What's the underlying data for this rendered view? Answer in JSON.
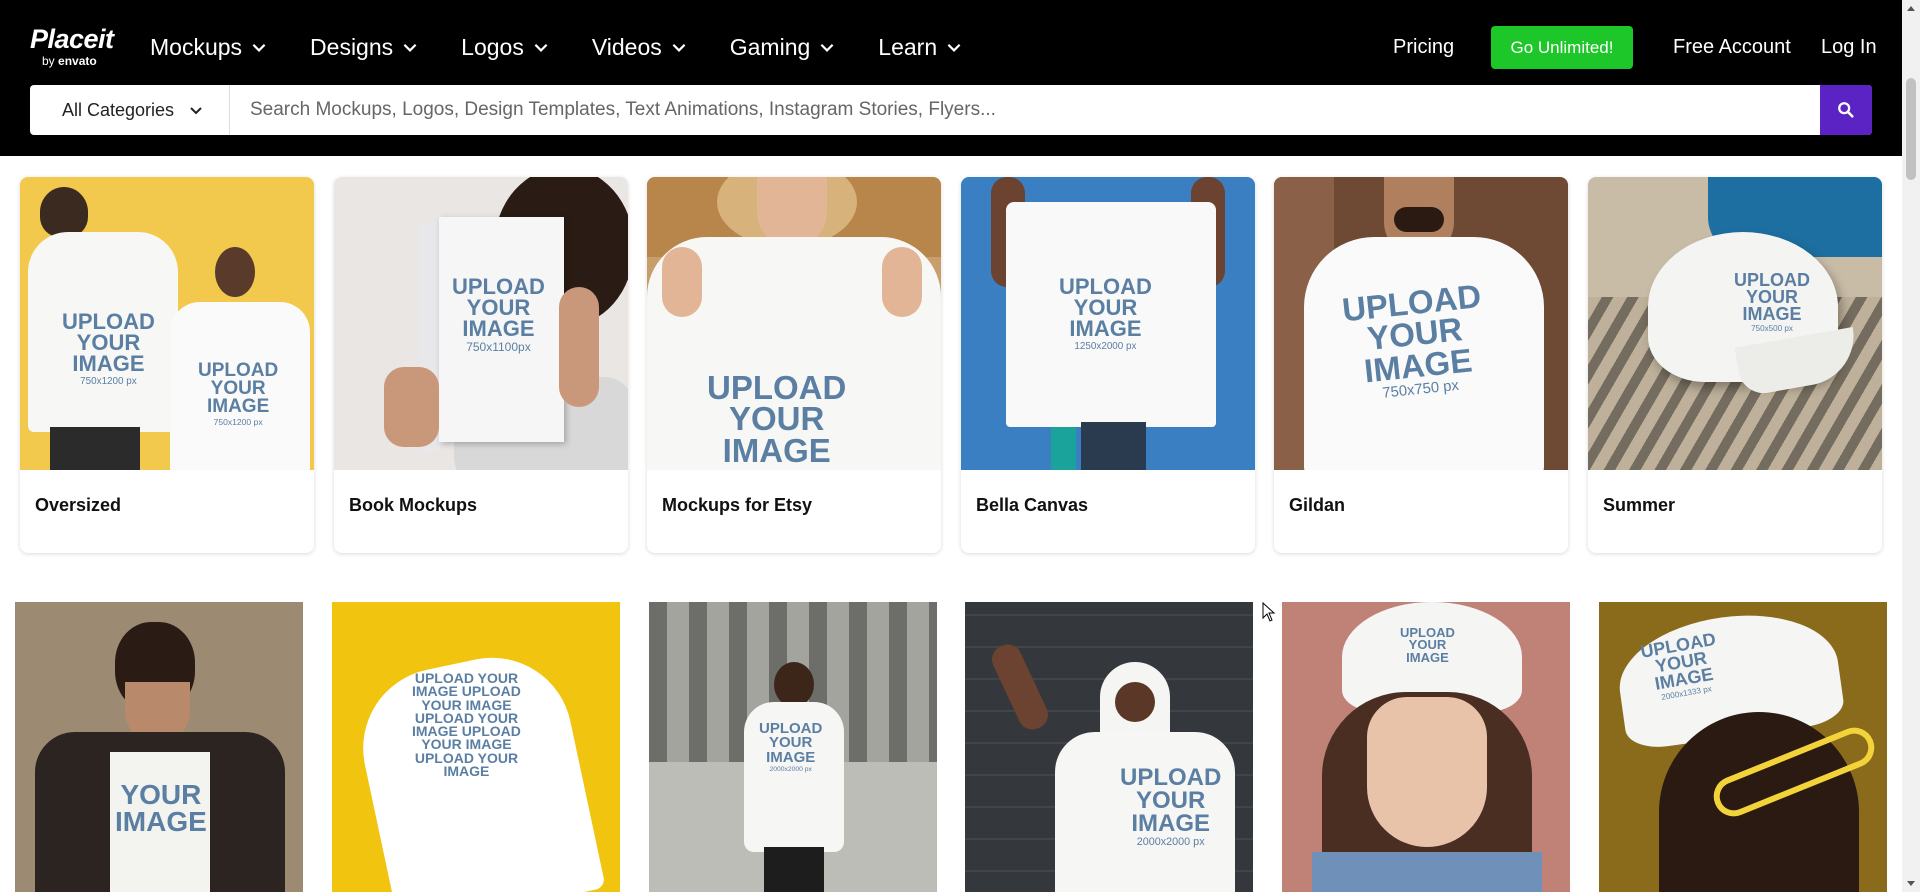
{
  "header": {
    "logo": {
      "main": "Placeit",
      "by": "by",
      "brand": "envato"
    },
    "nav": [
      {
        "label": "Mockups"
      },
      {
        "label": "Designs"
      },
      {
        "label": "Logos"
      },
      {
        "label": "Videos"
      },
      {
        "label": "Gaming"
      },
      {
        "label": "Learn"
      }
    ],
    "pricing": "Pricing",
    "cta": "Go Unlimited!",
    "free_account": "Free Account",
    "login": "Log In"
  },
  "search": {
    "category": "All Categories",
    "placeholder": "Search Mockups, Logos, Design Templates, Text Animations, Instagram Stories, Flyers..."
  },
  "categories": [
    {
      "label": "Oversized"
    },
    {
      "label": "Book Mockups"
    },
    {
      "label": "Mockups for Etsy"
    },
    {
      "label": "Bella Canvas"
    },
    {
      "label": "Gildan"
    },
    {
      "label": "Summer"
    }
  ],
  "mockup_text": {
    "upload": "UPLOAD",
    "your": "YOUR",
    "image": "IMAGE",
    "sizes": [
      "750x1200 px",
      "750x1200 px",
      "750x1100px",
      "750x1200",
      "1250x2000 px",
      "750x750 px",
      "750x500 px",
      "2000x2000 px",
      "2000x2000 px",
      "2000x2000 px",
      "2000x1333 px"
    ]
  },
  "colors": {
    "header_bg": "#000000",
    "cta_bg": "#1ec729",
    "search_button_bg": "#5b22c4",
    "mockup_text": "#5b7fa3"
  },
  "icons": [
    "chevron-down-icon",
    "search-icon",
    "cursor-icon"
  ]
}
